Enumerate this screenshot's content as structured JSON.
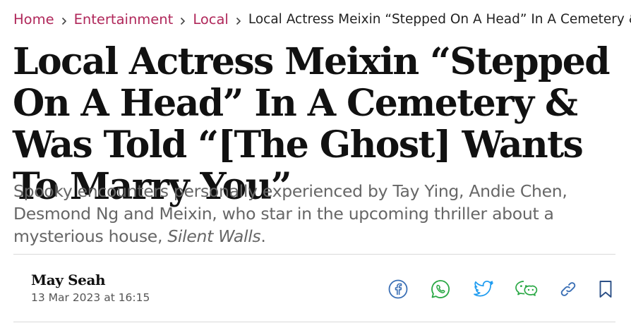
{
  "breadcrumb": {
    "items": [
      {
        "label": "Home"
      },
      {
        "label": "Entertainment"
      },
      {
        "label": "Local"
      }
    ],
    "current": "Local Actress Meixin “Stepped On A Head” In A Cemetery & W"
  },
  "article": {
    "headline": "Local Actress Meixin “Stepped On A Head” In A Cemetery & Was Told “[The Ghost] Wants To Marry You”",
    "dek_text": "Spooky encounters personally experienced by Tay Ying, Andie Chen, Desmond Ng and Meixin, who star in the upcoming thriller about a mysterious house, ",
    "dek_title": "Silent Walls",
    "dek_end": ".",
    "author": "May Seah",
    "published": "13 Mar 2023 at 16:15"
  },
  "share": {
    "icons": [
      "facebook-icon",
      "whatsapp-icon",
      "twitter-icon",
      "wechat-icon",
      "copy-link-icon",
      "bookmark-icon"
    ]
  },
  "colors": {
    "accent": "#b0275a",
    "share_blue": "#3a6fb5",
    "share_green": "#2aa845",
    "twitter_blue": "#1d9bf0",
    "text": "#111111",
    "muted": "#666666"
  }
}
